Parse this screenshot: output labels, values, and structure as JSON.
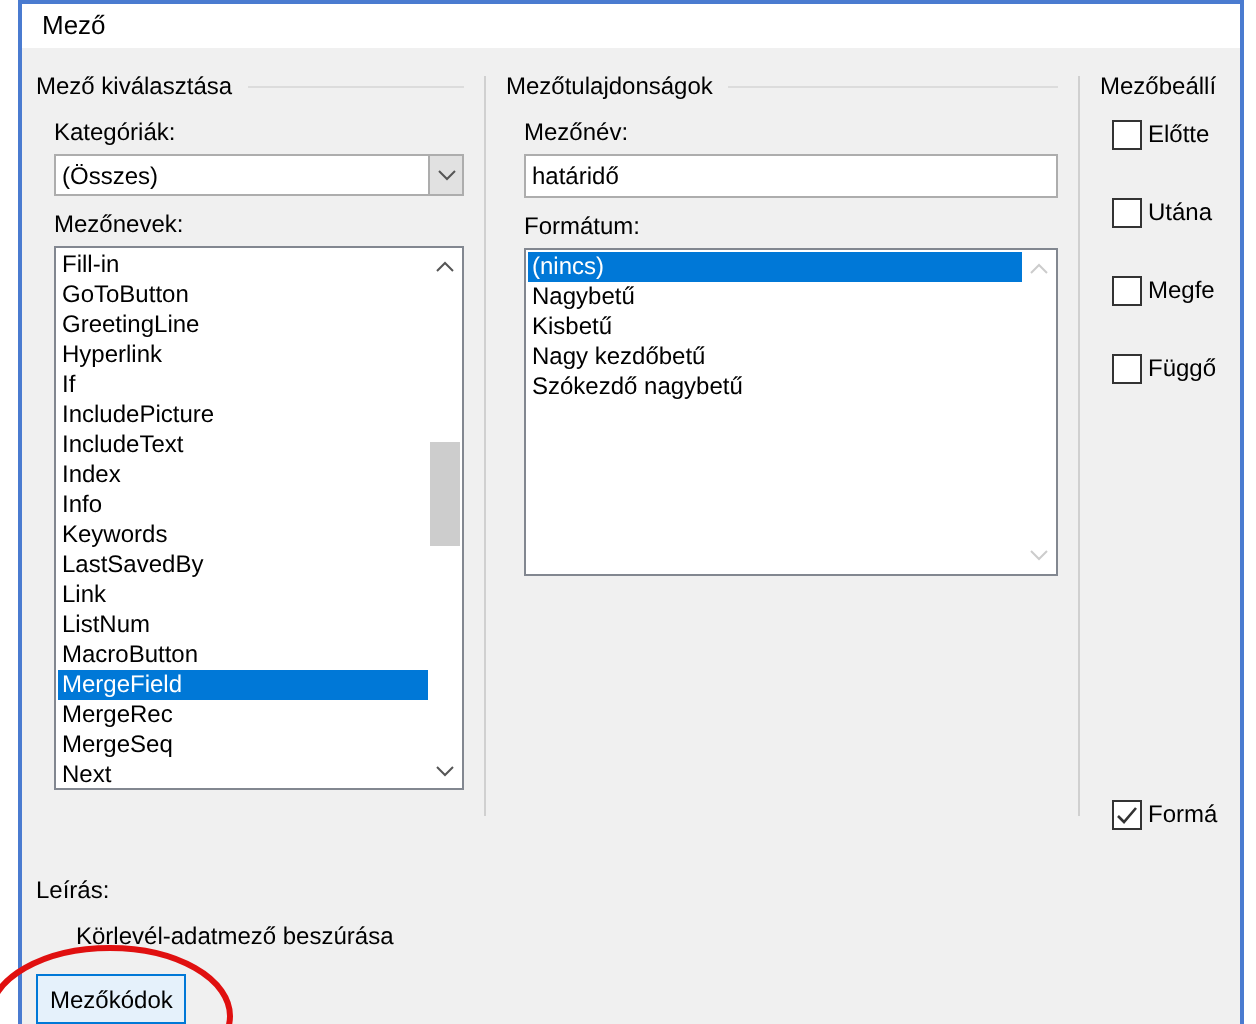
{
  "window": {
    "title": "Mező"
  },
  "field_selection": {
    "title": "Mező kiválasztása",
    "categories_label": "Kategóriák:",
    "category_value": "(Összes)",
    "field_names_label": "Mezőnevek:",
    "field_names": [
      {
        "label": "Fill-in",
        "selected": false
      },
      {
        "label": "GoToButton",
        "selected": false
      },
      {
        "label": "GreetingLine",
        "selected": false
      },
      {
        "label": "Hyperlink",
        "selected": false
      },
      {
        "label": "If",
        "selected": false
      },
      {
        "label": "IncludePicture",
        "selected": false
      },
      {
        "label": "IncludeText",
        "selected": false
      },
      {
        "label": "Index",
        "selected": false
      },
      {
        "label": "Info",
        "selected": false
      },
      {
        "label": "Keywords",
        "selected": false
      },
      {
        "label": "LastSavedBy",
        "selected": false
      },
      {
        "label": "Link",
        "selected": false
      },
      {
        "label": "ListNum",
        "selected": false
      },
      {
        "label": "MacroButton",
        "selected": false
      },
      {
        "label": "MergeField",
        "selected": true
      },
      {
        "label": "MergeRec",
        "selected": false
      },
      {
        "label": "MergeSeq",
        "selected": false
      },
      {
        "label": "Next",
        "selected": false
      }
    ]
  },
  "field_properties": {
    "title": "Mezőtulajdonságok",
    "name_label": "Mezőnév:",
    "name_value": "határidő",
    "format_label": "Formátum:",
    "formats": [
      {
        "label": "(nincs)",
        "selected": true
      },
      {
        "label": "Nagybetű",
        "selected": false
      },
      {
        "label": "Kisbetű",
        "selected": false
      },
      {
        "label": "Nagy kezdőbetű",
        "selected": false
      },
      {
        "label": "Szókezdő nagybetű",
        "selected": false
      }
    ]
  },
  "field_options": {
    "title": "Mezőbeállí",
    "options": [
      {
        "label": "Előtte",
        "checked": false
      },
      {
        "label": "Utána",
        "checked": false
      },
      {
        "label": "Megfe",
        "checked": false
      },
      {
        "label": "Függő",
        "checked": false
      }
    ],
    "bottom_option": {
      "label": "Formá",
      "checked": true
    }
  },
  "description": {
    "label": "Leírás:",
    "text": "Körlevél-adatmező beszúrása"
  },
  "buttons": [
    "Mezőkódok"
  ]
}
